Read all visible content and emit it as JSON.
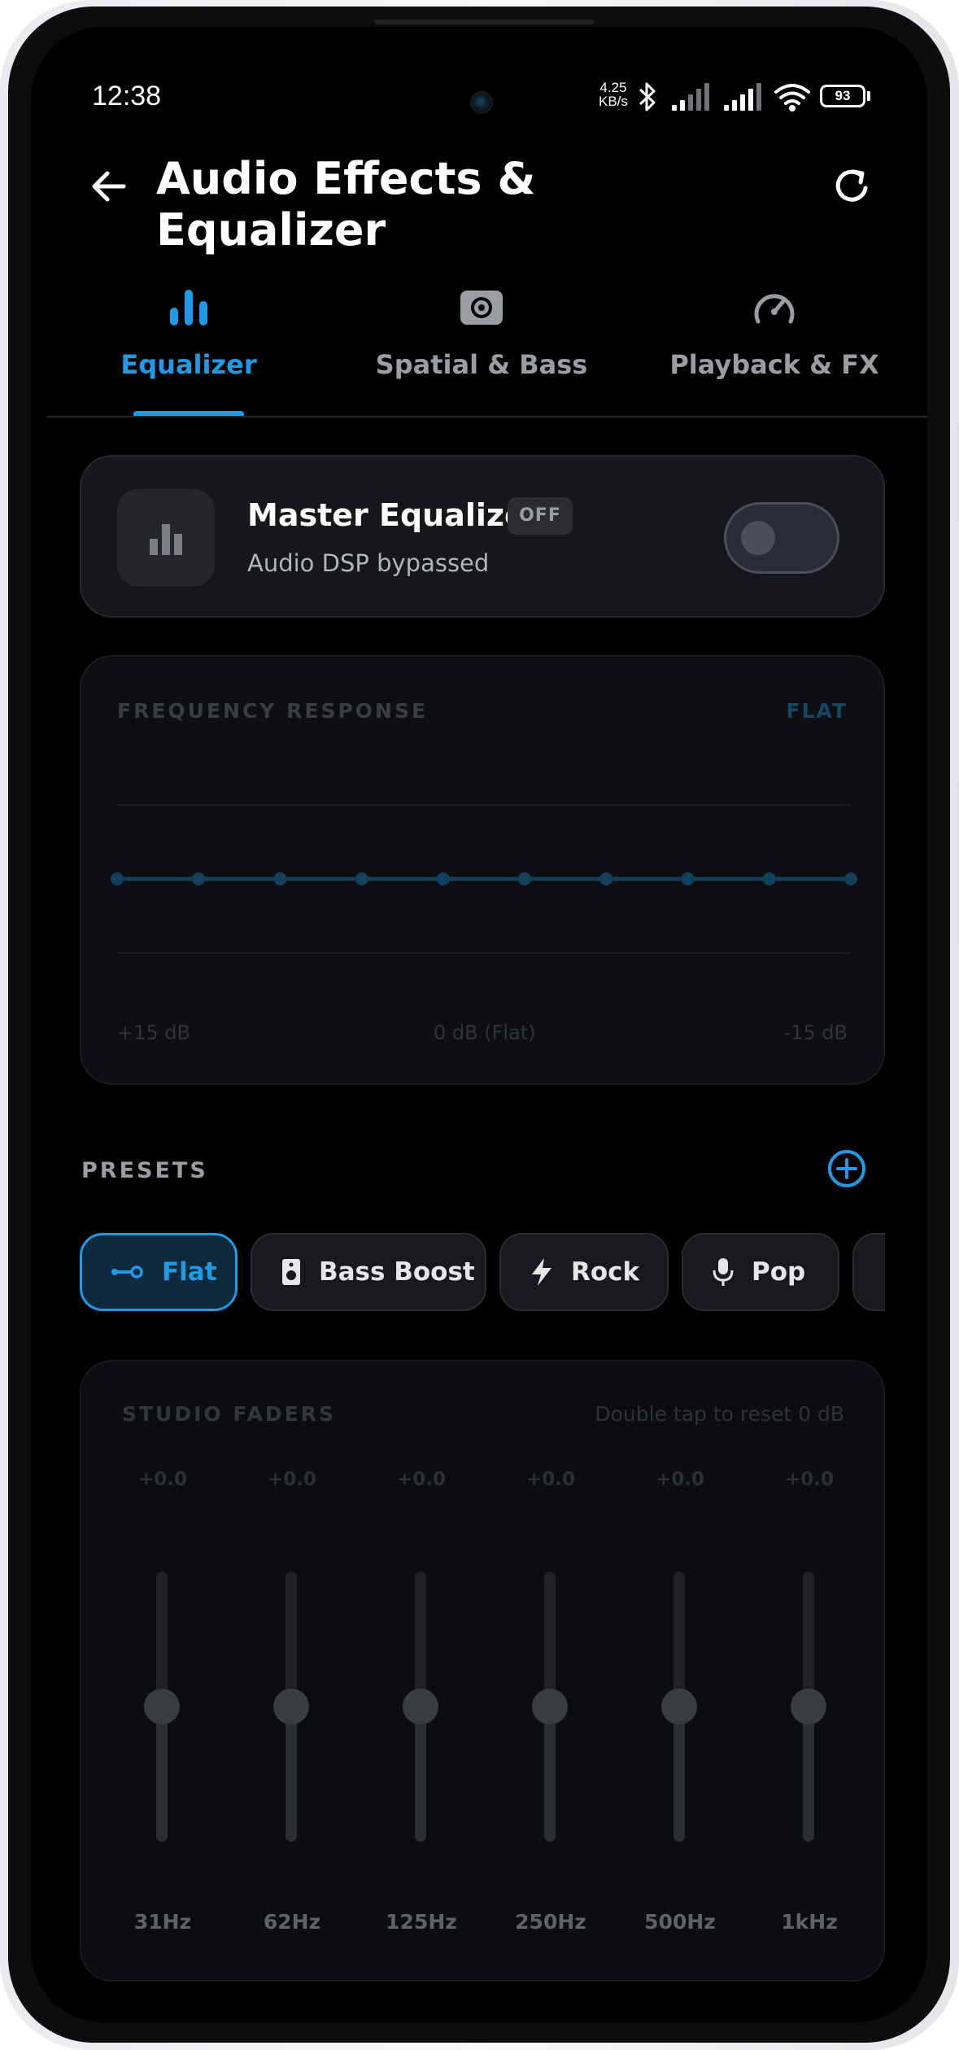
{
  "status_bar": {
    "time": "12:38",
    "net_speed_value": "4.25",
    "net_speed_unit": "KB/s",
    "battery": "93"
  },
  "header": {
    "title": "Audio Effects & Equalizer",
    "back_icon": "arrow-left-icon",
    "refresh_icon": "refresh-icon"
  },
  "tabs": [
    {
      "label": "Equalizer",
      "icon": "bars-icon",
      "active": true
    },
    {
      "label": "Spatial & Bass",
      "icon": "speaker-icon",
      "active": false
    },
    {
      "label": "Playback & FX",
      "icon": "gauge-icon",
      "active": false
    }
  ],
  "master": {
    "title": "Master Equalizer",
    "badge": "OFF",
    "subtitle": "Audio DSP bypassed",
    "enabled": false
  },
  "frequency_response": {
    "label": "FREQUENCY RESPONSE",
    "preset_tag": "FLAT",
    "ticks": [
      "+15 dB",
      "0 dB (Flat)",
      "-15 dB"
    ],
    "points_db": [
      0,
      0,
      0,
      0,
      0,
      0,
      0,
      0,
      0,
      0
    ]
  },
  "presets": {
    "label": "PRESETS",
    "items": [
      {
        "label": "Flat",
        "icon": "flat-line-icon",
        "selected": true
      },
      {
        "label": "Bass Boost",
        "icon": "speaker-icon",
        "selected": false
      },
      {
        "label": "Rock",
        "icon": "lightning-icon",
        "selected": false
      },
      {
        "label": "Pop",
        "icon": "microphone-icon",
        "selected": false
      }
    ]
  },
  "faders": {
    "label": "STUDIO FADERS",
    "hint": "Double tap to reset 0 dB",
    "bands": [
      {
        "freq": "31Hz",
        "value": "+0.0"
      },
      {
        "freq": "62Hz",
        "value": "+0.0"
      },
      {
        "freq": "125Hz",
        "value": "+0.0"
      },
      {
        "freq": "250Hz",
        "value": "+0.0"
      },
      {
        "freq": "500Hz",
        "value": "+0.0"
      },
      {
        "freq": "1kHz",
        "value": "+0.0"
      }
    ]
  },
  "colors": {
    "accent": "#1e9be6",
    "background": "#000000",
    "card": "#15171b"
  }
}
